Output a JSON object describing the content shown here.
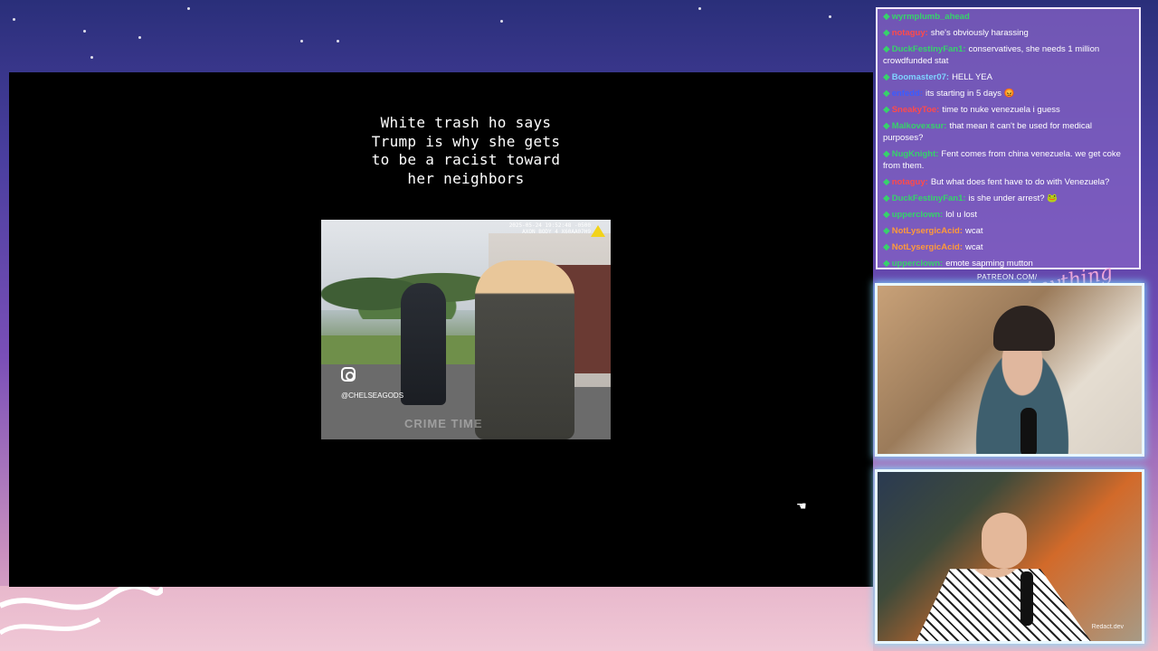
{
  "video": {
    "caption": "White trash ho says Trump is why she gets to be a racist toward her neighbors",
    "clip_timestamp": "2025-05-24 19:52:48 -0500",
    "clip_device": "AXON BODY 4 X60AA07H9",
    "instagram_handle": "@CHELSEAGODS",
    "watermark": "CRIME TIME"
  },
  "chat": {
    "messages": [
      {
        "user": "wyrmplumb_ahead",
        "text": "",
        "color": "#37d26b"
      },
      {
        "user": "notaguy:",
        "text": "she's obviously harassing",
        "color": "#ff4a4a"
      },
      {
        "user": "DuckFestinyFan1:",
        "text": "conservatives, she needs 1 million crowdfunded stat",
        "color": "#37d26b"
      },
      {
        "user": "Boomaster07:",
        "text": "HELL YEA",
        "color": "#7fd3ff"
      },
      {
        "user": "enfedd:",
        "text": "its starting in 5 days 😡",
        "color": "#3a5cff"
      },
      {
        "user": "SneakyToe:",
        "text": "time to nuke venezuela i guess",
        "color": "#ff4a4a"
      },
      {
        "user": "Malkovexsur:",
        "text": "that mean it can't be used for medical purposes?",
        "color": "#37d26b"
      },
      {
        "user": "NugKnight:",
        "text": "Fent comes from china venezuela. we get coke from them.",
        "color": "#37d26b"
      },
      {
        "user": "notaguy:",
        "text": "But what does fent have to do with Venezuela?",
        "color": "#ff4a4a"
      },
      {
        "user": "DuckFestinyFan1:",
        "text": "is she under arrest? 🐸",
        "color": "#37d26b"
      },
      {
        "user": "upperclown:",
        "text": "lol u lost",
        "color": "#37d26b"
      },
      {
        "user": "NotLysergicAcid:",
        "text": "wcat",
        "color": "#ff9a3a"
      },
      {
        "user": "NotLysergicAcid:",
        "text": "wcat",
        "color": "#ff9a3a"
      },
      {
        "user": "upperclown:",
        "text": "emote sapming mutton",
        "color": "#37d26b"
      }
    ]
  },
  "overlay": {
    "patreon_label": "PATREON.COM/",
    "signature": "Anything Else?"
  },
  "cams": {
    "cam2_label": "Redact.dev"
  },
  "colors": {
    "accent_frame": "#e8f7ff",
    "chat_bg": "#8462c4"
  }
}
